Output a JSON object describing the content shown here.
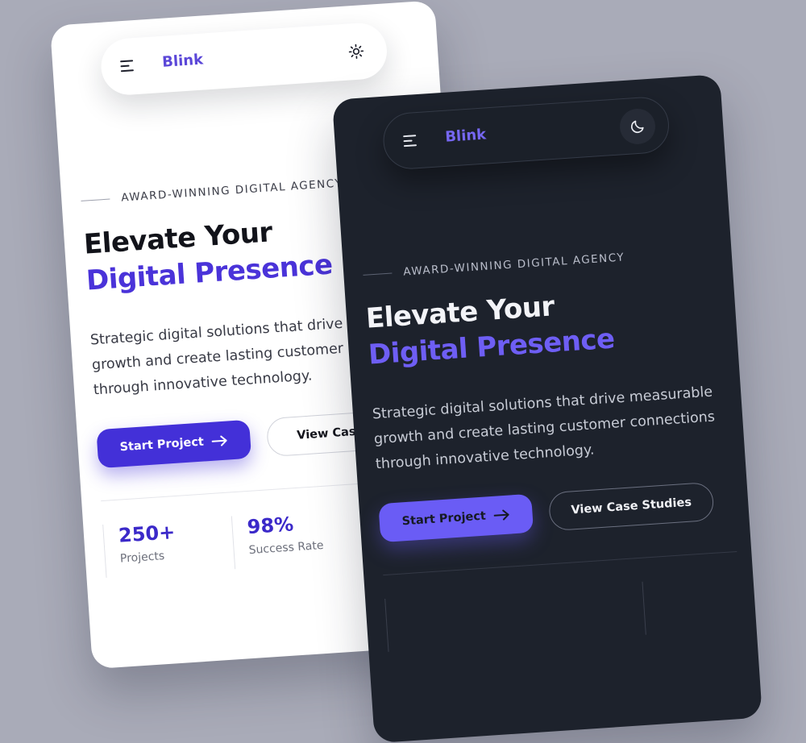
{
  "colors": {
    "background": "#a9abb8",
    "light_card": "#ffffff",
    "dark_card": "#1d222c",
    "accent_light": "#4a33d9",
    "accent_dark": "#6e5ef4"
  },
  "light": {
    "nav": {
      "brand": "Blink",
      "menu_icon": "menu-icon",
      "mode_icon": "sun-icon"
    },
    "eyebrow": "AWARD-WINNING DIGITAL AGENCY",
    "headline_line1": "Elevate Your",
    "headline_line2": "Digital Presence",
    "subtext": "Strategic digital solutions that drive measurable growth and create lasting customer connections through innovative technology.",
    "primary_button": "Start Project",
    "primary_button_icon": "arrow-right-icon",
    "secondary_button": "View Case Studies",
    "stats": [
      {
        "value": "250+",
        "label": "Projects"
      },
      {
        "value": "98%",
        "label": "Success Rate"
      }
    ]
  },
  "dark": {
    "nav": {
      "brand": "Blink",
      "menu_icon": "menu-icon",
      "mode_icon": "moon-icon"
    },
    "eyebrow": "AWARD-WINNING DIGITAL AGENCY",
    "headline_line1": "Elevate Your",
    "headline_line2": "Digital Presence",
    "subtext": "Strategic digital solutions that drive measurable growth and create lasting customer connections through innovative technology.",
    "primary_button": "Start Project",
    "primary_button_icon": "arrow-right-icon",
    "secondary_button": "View Case Studies"
  }
}
